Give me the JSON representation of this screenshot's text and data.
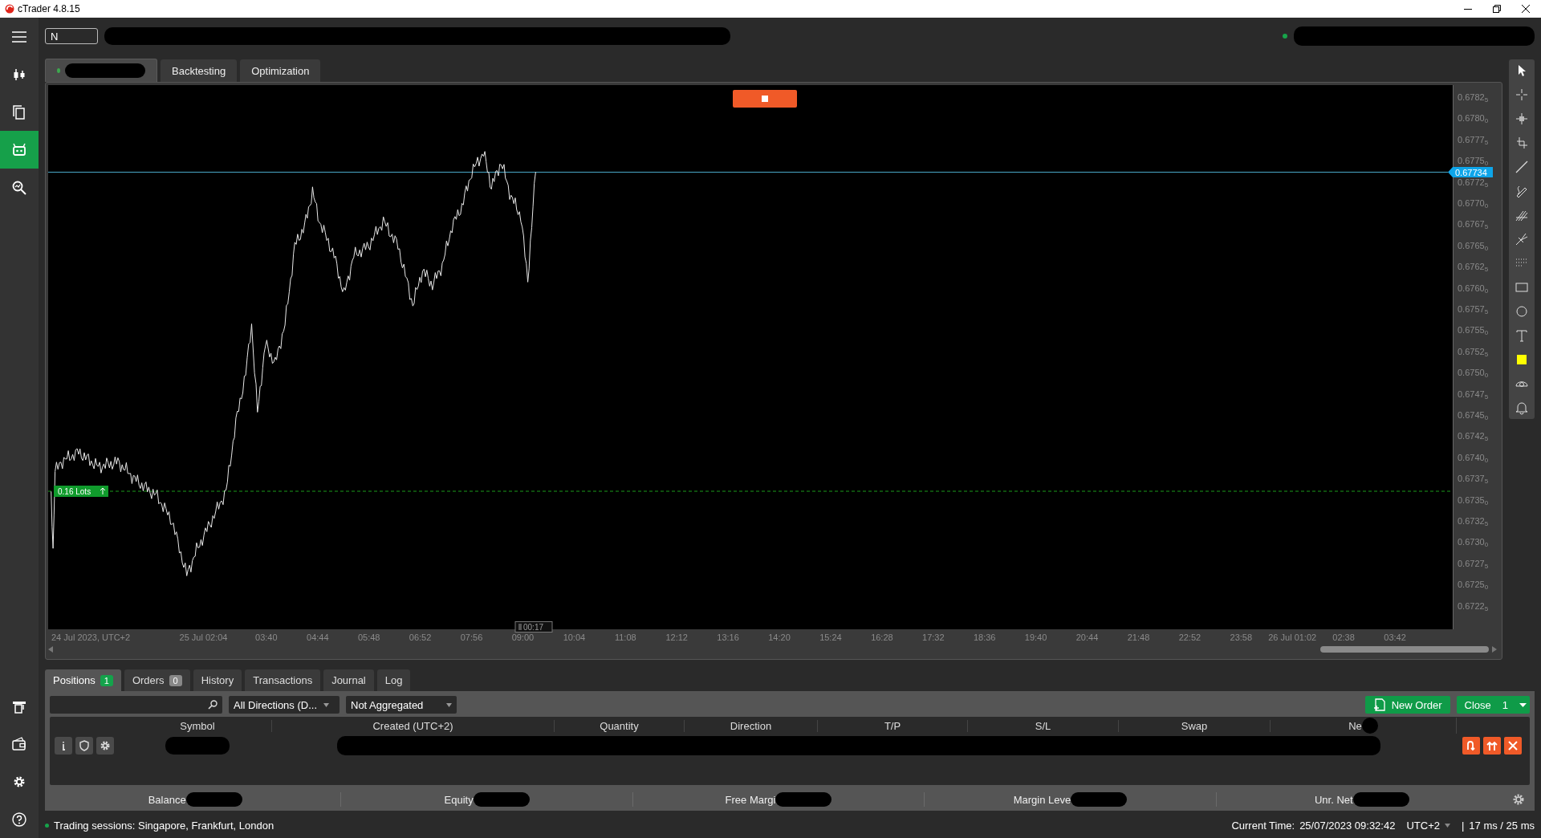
{
  "window": {
    "title": "cTrader 4.8.15"
  },
  "rail": {
    "items": [
      {
        "kind": "chart",
        "selected": false
      },
      {
        "kind": "copy",
        "selected": false
      },
      {
        "kind": "robot",
        "selected": true
      },
      {
        "kind": "analyze",
        "selected": false
      }
    ],
    "bottom_items": [
      {
        "kind": "deposit"
      },
      {
        "kind": "wallet"
      },
      {
        "kind": "settings"
      },
      {
        "kind": "help"
      }
    ]
  },
  "top_bar": {
    "symbol_field": {
      "value": "N"
    },
    "connected": true
  },
  "chart_tabs": [
    {
      "kind": "chart",
      "live": true,
      "selected": true
    },
    {
      "kind": "text",
      "label": "Backtesting",
      "selected": false
    },
    {
      "kind": "text",
      "label": "Optimization",
      "selected": false
    }
  ],
  "chart": {
    "price_ticks": [
      "0.6782$_{5}$",
      "0.6780$_{0}$",
      "0.6777$_{5}$",
      "0.6775$_{0}$",
      "0.6772$_{5}$",
      "0.6770$_{0}$",
      "0.6767$_{5}$",
      "0.6765$_{0}$",
      "0.6762$_{5}$",
      "0.6760$_{0}$",
      "0.6757$_{5}$",
      "0.6755$_{0}$",
      "0.6752$_{5}$",
      "0.6750$_{0}$",
      "0.6747$_{5}$",
      "0.6745$_{0}$",
      "0.6742$_{5}$",
      "0.6740$_{0}$",
      "0.6737$_{5}$",
      "0.6735$_{0}$",
      "0.6732$_{5}$",
      "0.6730$_{0}$",
      "0.6727$_{5}$",
      "0.6725$_{0}$",
      "0.6722$_{5}$"
    ],
    "current_price": "0.67734",
    "position_label": "0.16 Lots",
    "time_labels": [
      "24 Jul 2023, UTC+2",
      "25 Jul 02:04",
      "03:40",
      "04:44",
      "05:48",
      "06:52",
      "07:56",
      "09:00",
      "10:04",
      "11:08",
      "12:12",
      "13:16",
      "14:20",
      "15:24",
      "16:28",
      "17:32",
      "18:36",
      "19:40",
      "20:44",
      "21:48",
      "22:52",
      "23:58",
      "26 Jul 01:02",
      "02:38",
      "03:42"
    ],
    "time_marker": "00:17"
  },
  "bottom_tabs": [
    {
      "label": "Positions",
      "count": "1",
      "selected": true
    },
    {
      "label": "Orders",
      "count": "0",
      "selected": false
    },
    {
      "label": "History",
      "selected": false
    },
    {
      "label": "Transactions",
      "selected": false
    },
    {
      "label": "Journal",
      "selected": false
    },
    {
      "label": "Log",
      "selected": false
    }
  ],
  "filters": {
    "direction": "All Directions (D...",
    "aggregation": "Not Aggregated"
  },
  "actions": {
    "new_order": "New Order",
    "close": "Close",
    "close_count": "1"
  },
  "table": {
    "columns": [
      "Symbol",
      "Created (UTC+2)",
      "Quantity",
      "Direction",
      "T/P",
      "S/L",
      "Swap",
      "Ne"
    ]
  },
  "summary": [
    "Balance",
    "Equity",
    "Free Margi",
    "Margin Leve",
    "Unr. Net"
  ],
  "status_bar": {
    "connected": true,
    "sessions": "Trading sessions: Singapore, Frankfurt, London",
    "time_label": "Current Time:",
    "time": "25/07/2023 09:32:42",
    "timezone": "UTC+2",
    "separator": "|",
    "latency": "17 ms / 25 ms"
  }
}
